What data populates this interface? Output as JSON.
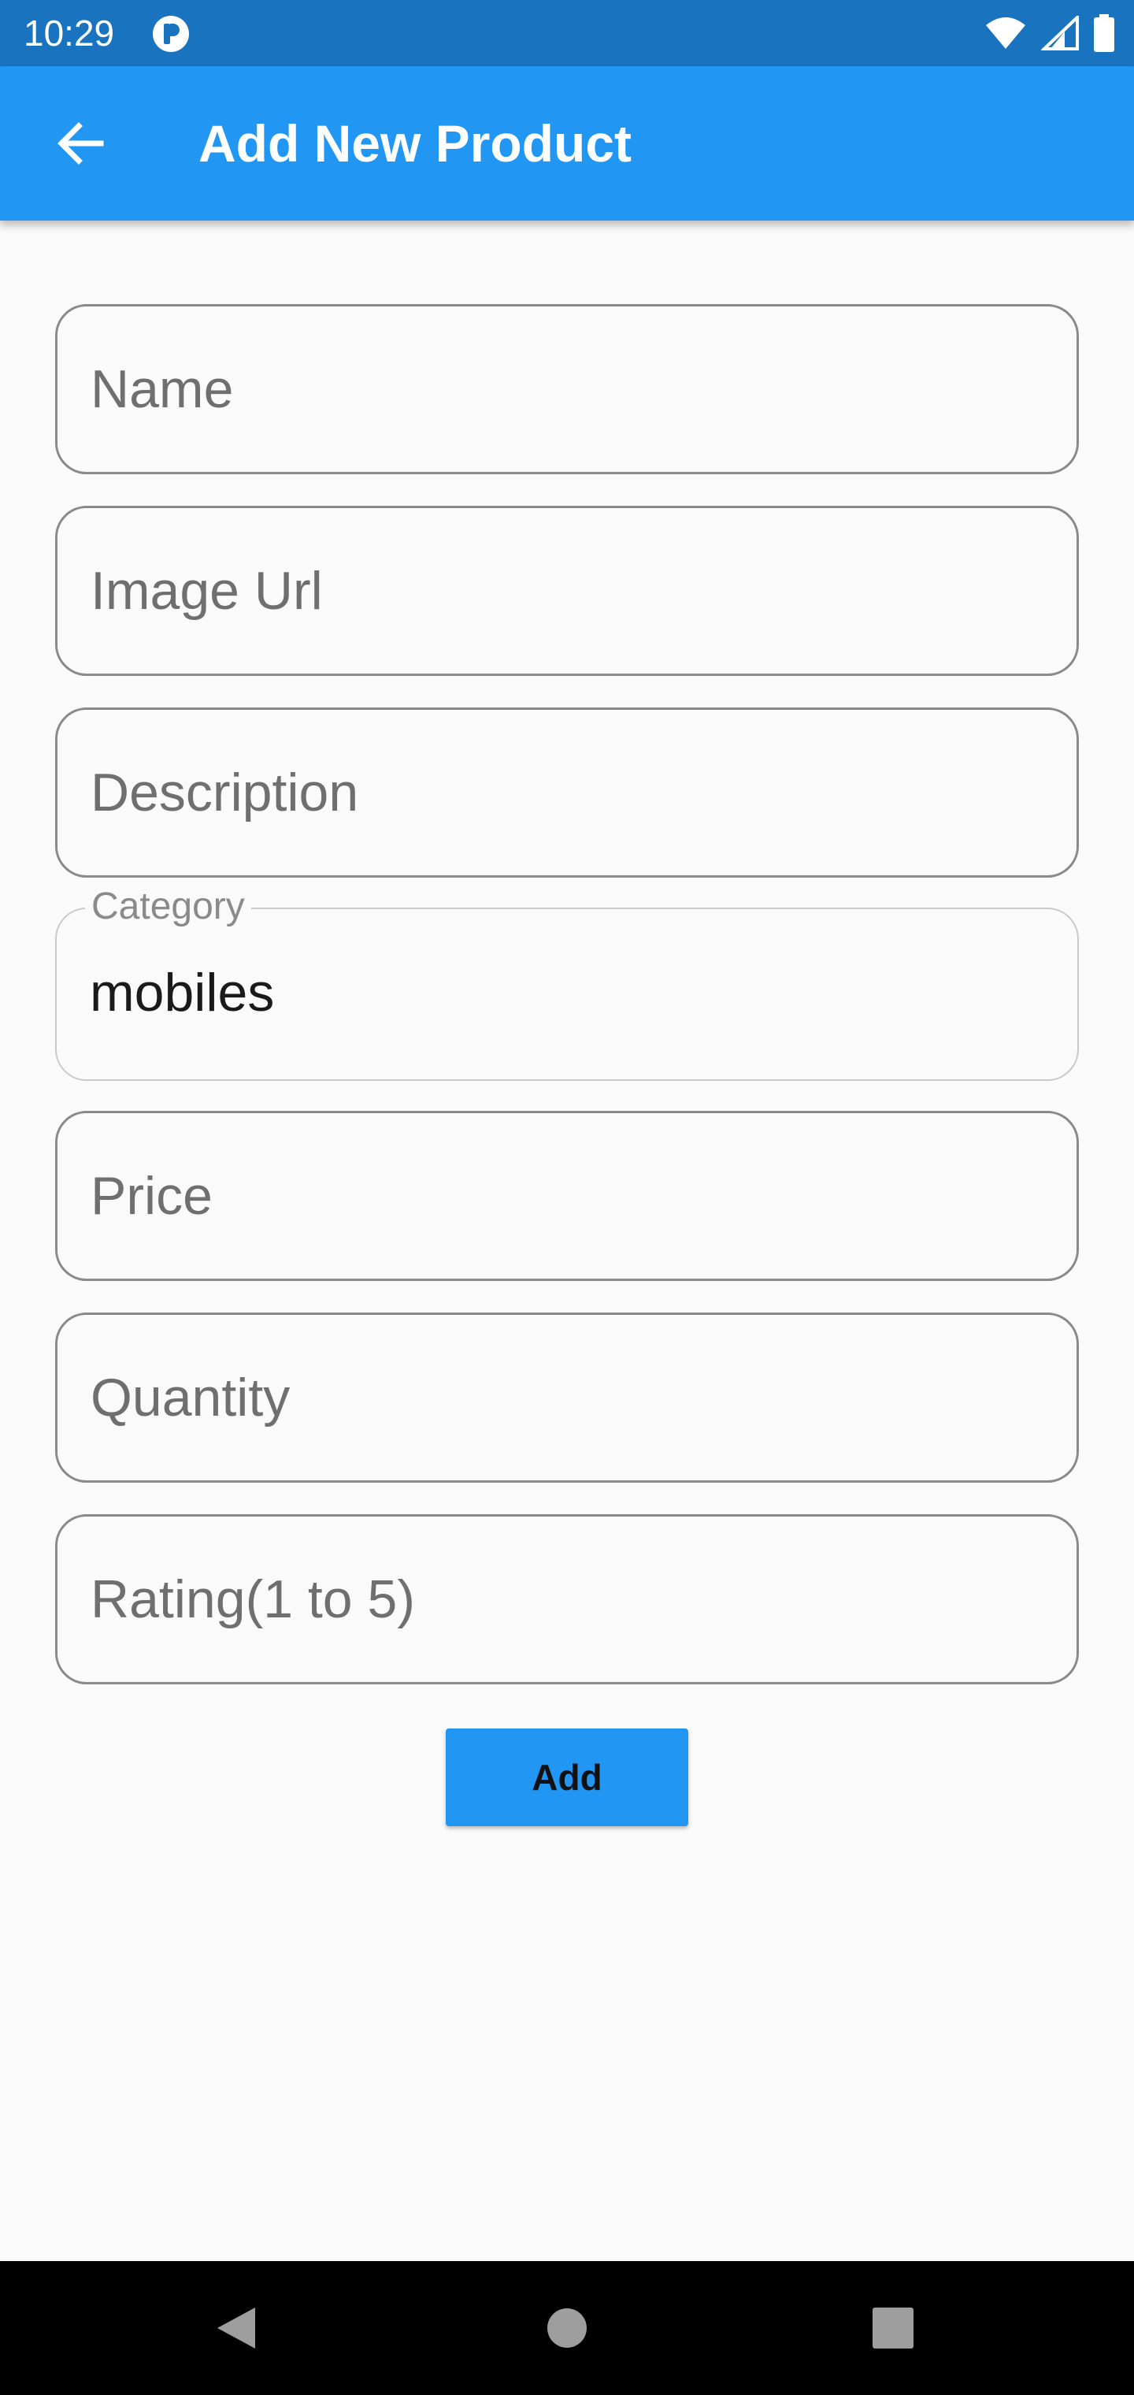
{
  "status_bar": {
    "time": "10:29",
    "icons": [
      "app-notification-icon",
      "wifi-icon",
      "cellular-signal-icon",
      "battery-icon"
    ]
  },
  "app_bar": {
    "back_icon": "arrow-back-icon",
    "title": "Add New Product",
    "color": "#2196f3"
  },
  "form": {
    "name": {
      "placeholder": "Name"
    },
    "image_url": {
      "placeholder": "Image Url"
    },
    "description": {
      "placeholder": "Description"
    },
    "category": {
      "label": "Category",
      "value": "mobiles"
    },
    "price": {
      "placeholder": "Price"
    },
    "quantity": {
      "placeholder": "Quantity"
    },
    "rating": {
      "placeholder": "Rating(1 to 5)"
    },
    "add_label": "Add"
  },
  "nav_bar": {
    "icons": [
      "back-triangle-icon",
      "home-circle-icon",
      "recents-square-icon"
    ]
  }
}
